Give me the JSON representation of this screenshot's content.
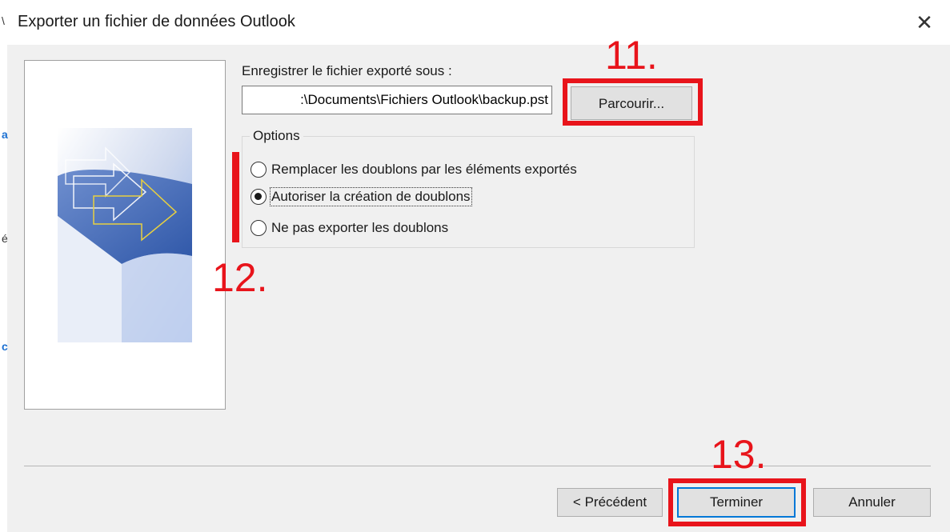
{
  "window": {
    "title": "Exporter un fichier de données Outlook",
    "close_icon": "close-icon"
  },
  "save_as": {
    "label": "Enregistrer le fichier exporté sous :",
    "path_value": ":\\Documents\\Fichiers Outlook\\backup.pst",
    "browse_label": "Parcourir..."
  },
  "options": {
    "legend": "Options",
    "items": [
      {
        "label": "Remplacer les doublons par les éléments exportés",
        "checked": false
      },
      {
        "label": "Autoriser la création de doublons",
        "checked": true
      },
      {
        "label": "Ne pas exporter les doublons",
        "checked": false
      }
    ]
  },
  "footer": {
    "back_label": "< Précédent",
    "finish_label": "Terminer",
    "cancel_label": "Annuler"
  },
  "annotations": {
    "step11": "11.",
    "step12": "12.",
    "step13": "13."
  },
  "colors": {
    "annotation_red": "#e8141b",
    "dialog_bg": "#f0f0f0",
    "focus_blue": "#0078d7"
  }
}
